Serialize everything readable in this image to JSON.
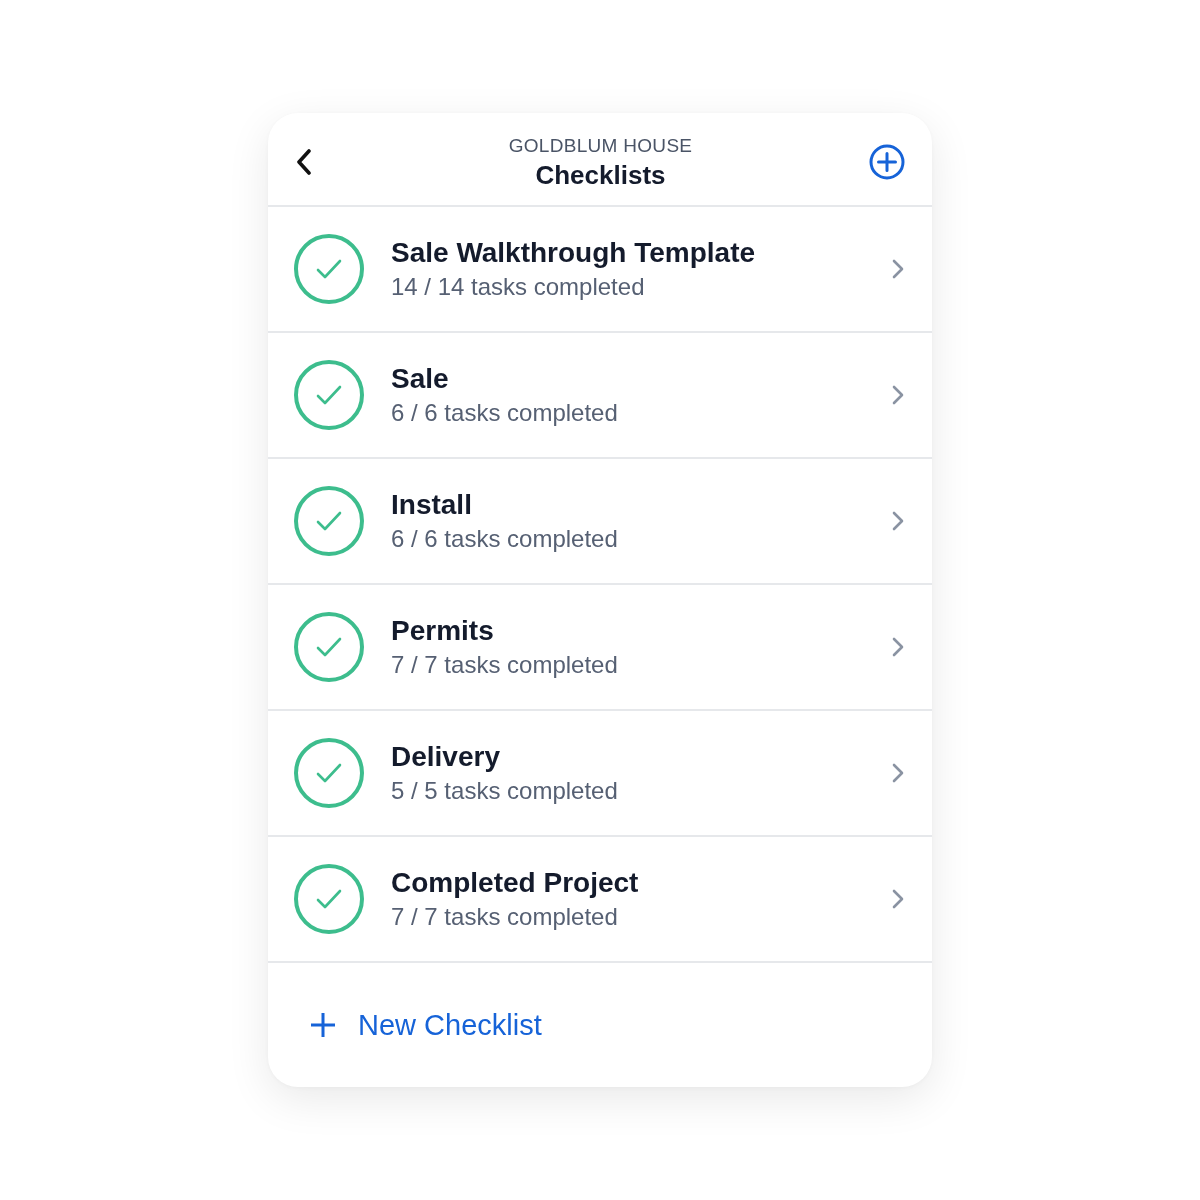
{
  "header": {
    "supertitle": "GOLDBLUM HOUSE",
    "title": "Checklists"
  },
  "checklists": [
    {
      "name": "Sale Walkthrough Template",
      "progress": "14 / 14 tasks completed",
      "complete": true
    },
    {
      "name": "Sale",
      "progress": "6 / 6 tasks completed",
      "complete": true
    },
    {
      "name": "Install",
      "progress": "6 / 6 tasks completed",
      "complete": true
    },
    {
      "name": "Permits",
      "progress": "7 / 7 tasks completed",
      "complete": true
    },
    {
      "name": "Delivery",
      "progress": "5 / 5 tasks completed",
      "complete": true
    },
    {
      "name": "Completed Project",
      "progress": "7 / 7 tasks completed",
      "complete": true
    }
  ],
  "footer": {
    "action": "New Checklist"
  }
}
